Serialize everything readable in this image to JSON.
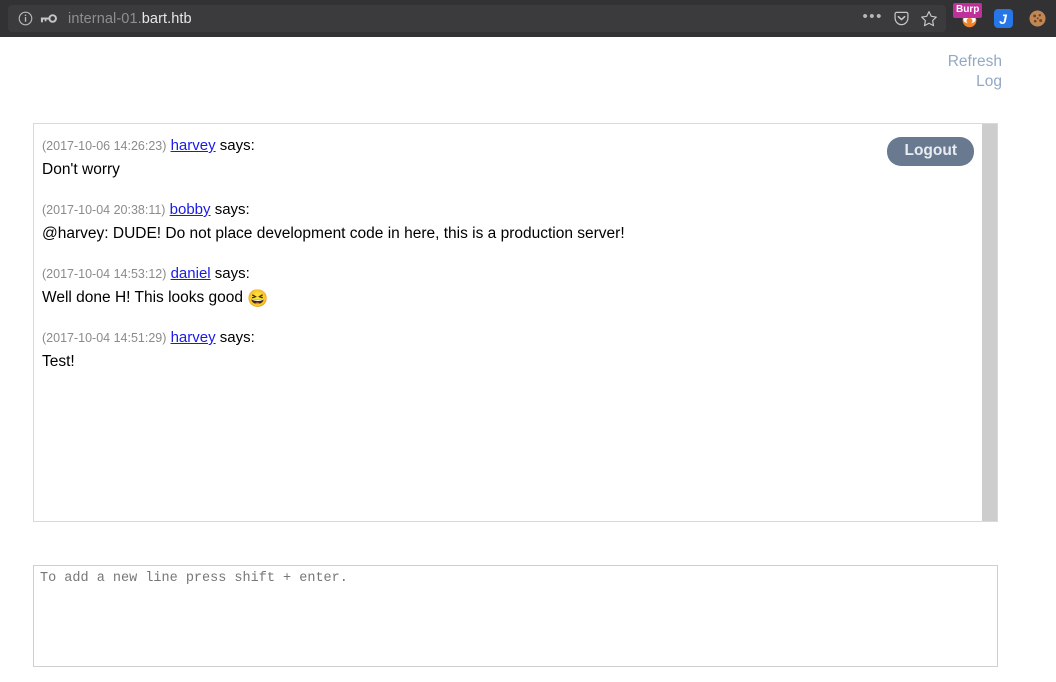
{
  "browser": {
    "url_prefix": "internal-01.",
    "url_host": "bart.htb",
    "info_icon": "info-circle-icon",
    "key_icon": "key-icon",
    "menu_dots": "•••",
    "pocket_icon": "pocket-icon",
    "star_icon": "star-icon",
    "extensions": [
      {
        "name": "burp-suite-icon",
        "badge": "Burp"
      },
      {
        "name": "jdownloader-icon",
        "label": "J"
      },
      {
        "name": "cookie-icon"
      }
    ]
  },
  "page": {
    "links": [
      {
        "label": "Refresh",
        "name": "refresh-link"
      },
      {
        "label": "Log",
        "name": "log-link"
      }
    ],
    "logout_label": "Logout",
    "messages": [
      {
        "timestamp": "(2017-10-06 14:26:23)",
        "user": "harvey",
        "says": "says:",
        "text": "Don't worry",
        "emoji": ""
      },
      {
        "timestamp": "(2017-10-04 20:38:11)",
        "user": "bobby",
        "says": "says:",
        "text": "@harvey: DUDE! Do not place development code in here, this is a production server!",
        "emoji": ""
      },
      {
        "timestamp": "(2017-10-04 14:53:12)",
        "user": "daniel",
        "says": "says:",
        "text": "Well done H! This looks good",
        "emoji": "😆"
      },
      {
        "timestamp": "(2017-10-04 14:51:29)",
        "user": "harvey",
        "says": "says:",
        "text": "Test!",
        "emoji": ""
      }
    ],
    "composer_placeholder": "To add a new line press shift + enter.",
    "composer_value": ""
  },
  "colors": {
    "chrome_bg": "#323234",
    "link_blue": "#92a8c4",
    "user_link": "#1a1ae6",
    "logout_bg": "#69798f",
    "scrollbar": "#cdcdcd"
  }
}
